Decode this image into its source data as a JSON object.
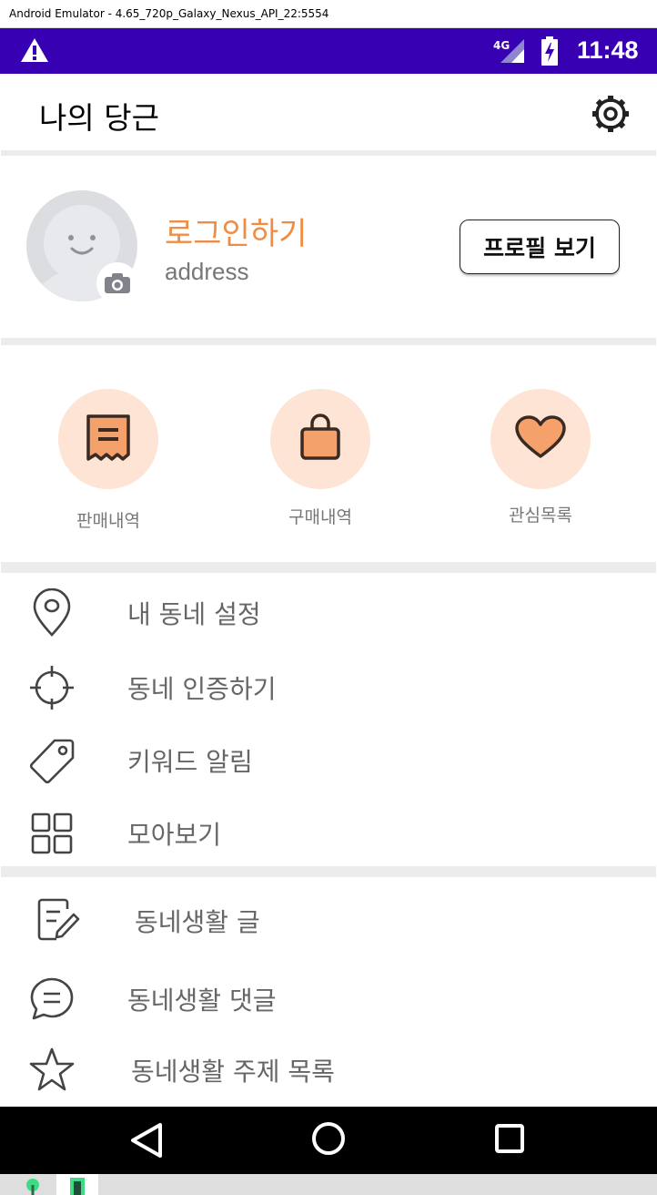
{
  "window": {
    "title": "Android Emulator - 4.65_720p_Galaxy_Nexus_API_22:5554"
  },
  "status_bar": {
    "time": "11:48",
    "network": "4G",
    "bg_color": "#3700b3"
  },
  "app_bar": {
    "title": "나의 당근",
    "settings_icon": "gear-icon"
  },
  "profile": {
    "login_text": "로그인하기",
    "address": "address",
    "button_label": "프로필 보기",
    "accent_color": "#ef8d45"
  },
  "shortcuts": [
    {
      "label": "판매내역",
      "icon": "receipt-icon"
    },
    {
      "label": "구매내역",
      "icon": "shopping-bag-icon"
    },
    {
      "label": "관심목록",
      "icon": "heart-icon"
    }
  ],
  "menu_group_1": [
    {
      "label": "내 동네 설정",
      "icon": "location-pin-icon"
    },
    {
      "label": "동네 인증하기",
      "icon": "crosshair-icon"
    },
    {
      "label": "키워드 알림",
      "icon": "tag-icon"
    },
    {
      "label": "모아보기",
      "icon": "grid-icon"
    }
  ],
  "menu_group_2": [
    {
      "label": "동네생활 글",
      "icon": "edit-note-icon"
    },
    {
      "label": "동네생활 댓글",
      "icon": "chat-bubble-icon"
    },
    {
      "label": "동네생활 주제 목록",
      "icon": "star-icon"
    }
  ]
}
